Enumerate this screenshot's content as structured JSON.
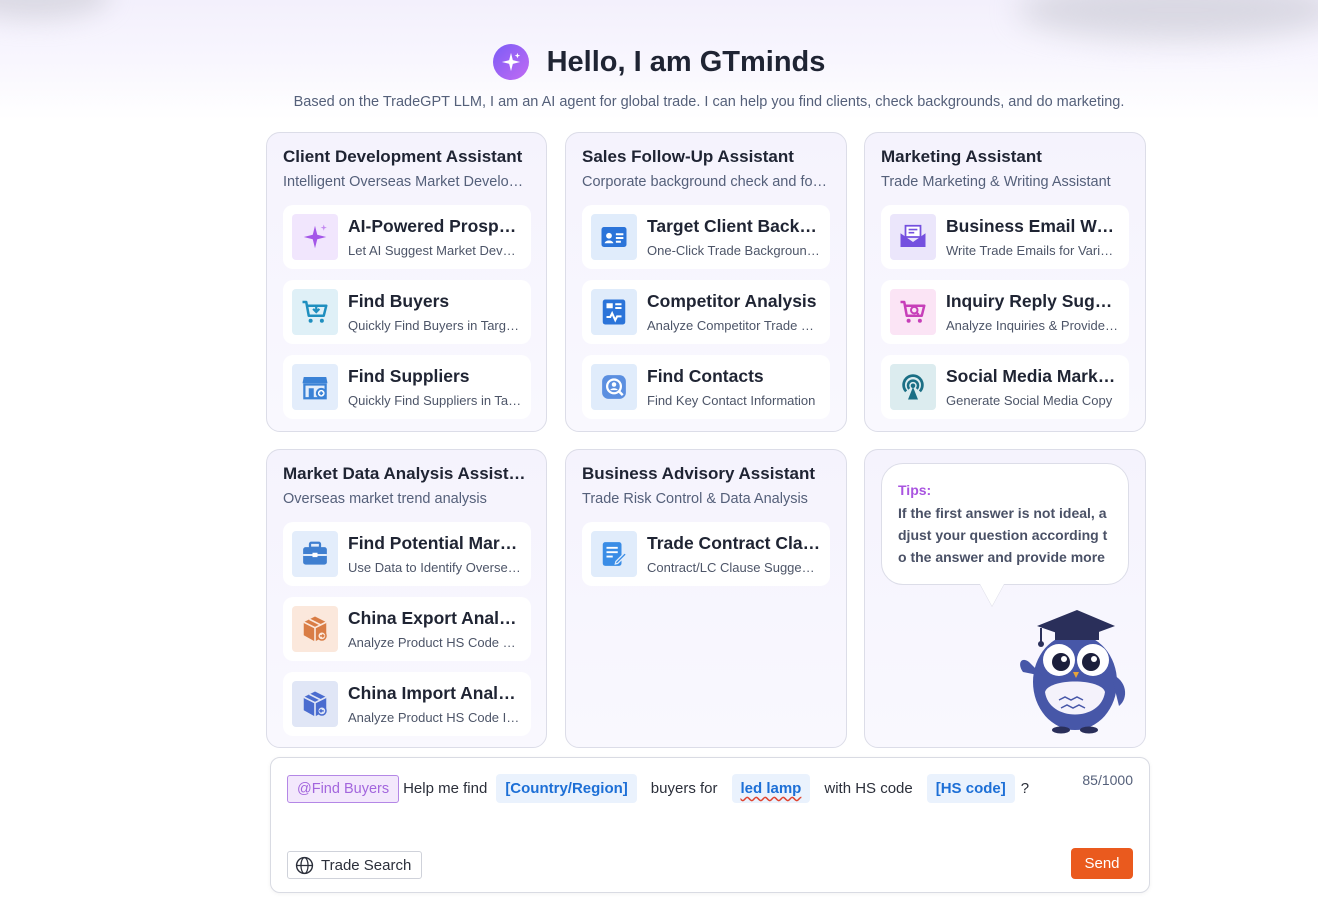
{
  "header": {
    "logo_icon": "sparkle-icon",
    "title": "Hello, I am GTminds",
    "subtitle": "Based on the TradeGPT LLM, I am an AI agent for global trade. I can help you find clients, check backgrounds, and do marketing."
  },
  "cards": [
    {
      "title": "Client Development Assistant",
      "desc": "Intelligent Overseas Market Development",
      "items": [
        {
          "name": "AI-Powered Prospecting",
          "desc": "Let AI Suggest Market Development",
          "icon": "sparkle-icon"
        },
        {
          "name": "Find Buyers",
          "desc": "Quickly Find Buyers in Target Markets",
          "icon": "cart-icon"
        },
        {
          "name": "Find Suppliers",
          "desc": "Quickly Find Suppliers in Target Markets",
          "icon": "store-icon"
        }
      ]
    },
    {
      "title": "Sales Follow-Up Assistant",
      "desc": "Corporate background check and follow-up",
      "items": [
        {
          "name": "Target Client Background Check",
          "desc": "One-Click Trade Background Check",
          "icon": "id-card-icon"
        },
        {
          "name": "Competitor Analysis",
          "desc": "Analyze Competitor Trade Data",
          "icon": "chart-doc-icon"
        },
        {
          "name": "Find Contacts",
          "desc": "Find Key Contact Information",
          "icon": "contact-search-icon"
        }
      ]
    },
    {
      "title": "Marketing Assistant",
      "desc": "Trade Marketing & Writing Assistant",
      "items": [
        {
          "name": "Business Email Writing",
          "desc": "Write Trade Emails for Various Scenarios",
          "icon": "mail-icon"
        },
        {
          "name": "Inquiry Reply Suggestions",
          "desc": "Analyze Inquiries & Provide Replies",
          "icon": "cart-search-icon"
        },
        {
          "name": "Social Media Marketing",
          "desc": "Generate Social Media Copy",
          "icon": "broadcast-icon"
        }
      ]
    },
    {
      "title": "Market Data Analysis Assistant",
      "desc": "Overseas market trend analysis",
      "items": [
        {
          "name": "Find Potential Markets",
          "desc": "Use Data to Identify Overseas Markets",
          "icon": "briefcase-icon"
        },
        {
          "name": "China Export Analysis",
          "desc": "Analyze Product HS Code Export Data",
          "icon": "export-box-icon"
        },
        {
          "name": "China Import Analysis",
          "desc": "Analyze Product HS Code Import Data",
          "icon": "import-box-icon"
        }
      ]
    },
    {
      "title": "Business Advisory Assistant",
      "desc": "Trade Risk Control & Data Analysis",
      "items": [
        {
          "name": "Trade Contract Clause",
          "desc": "Contract/LC Clause Suggestions",
          "icon": "contract-edit-icon"
        }
      ]
    }
  ],
  "tips": {
    "label": "Tips:",
    "text": "If the first answer is not ideal, adjust your question according to the answer and provide more details.",
    "mascot_icon": "owl-mascot-icon"
  },
  "composer": {
    "mention": "@Find Buyers",
    "text1": "Help me find",
    "slot1": "[Country/Region]",
    "text2": "buyers for",
    "slot2": "led lamp",
    "text3": "with HS code",
    "slot3": "[HS code]",
    "text4": "?",
    "counter": "85/1000",
    "trade_search_label": "Trade Search",
    "trade_search_icon": "globe-icon",
    "send_label": "Send",
    "send_color": "#ea5a1e"
  }
}
